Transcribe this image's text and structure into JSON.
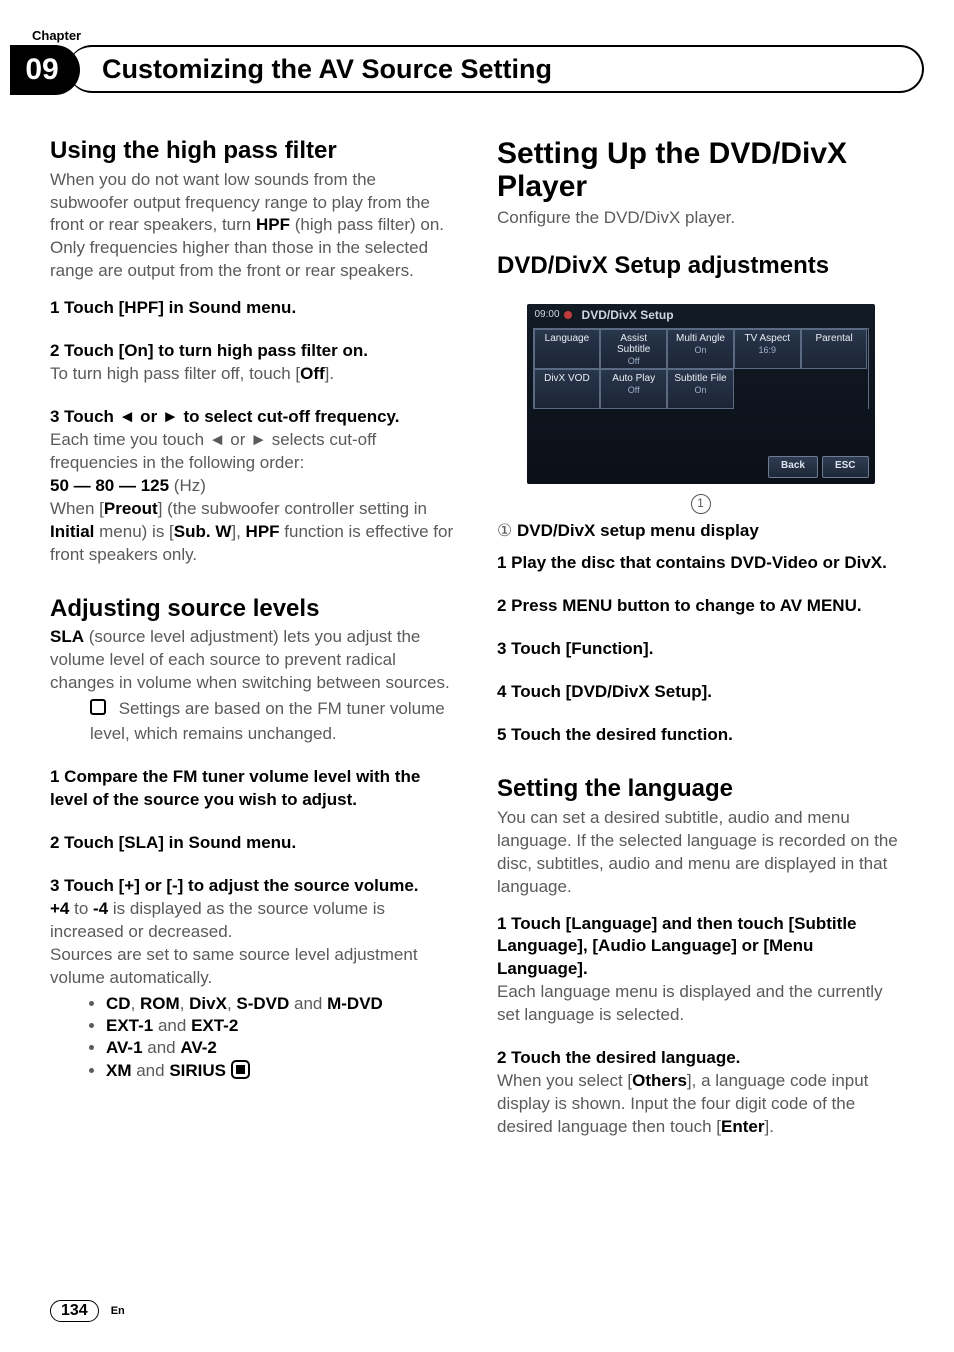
{
  "header": {
    "chapter_label": "Chapter",
    "chapter_number": "09",
    "title": "Customizing the AV Source Setting"
  },
  "left": {
    "high_pass": {
      "heading": "Using the high pass filter",
      "intro_a": "When you do not want low sounds from the subwoofer output frequency range to play from the front or rear speakers, turn ",
      "intro_bold": "HPF",
      "intro_b": " (high pass filter) on. Only frequencies higher than those in the selected range are output from the front or rear speakers.",
      "step1": "1    Touch [HPF] in Sound menu.",
      "step2": "2    Touch [On] to turn high pass filter on.",
      "step2_follow_a": "To turn high pass filter off, touch [",
      "step2_follow_bold": "Off",
      "step2_follow_b": "].",
      "step3": "3    Touch ◄ or ► to select cut-off frequency.",
      "step3_follow": "Each time you touch ◄ or ► selects cut-off frequencies in the following order:",
      "freq_line": "50 — 80 — 125",
      "freq_unit": " (Hz)",
      "preout_a": "When [",
      "preout_b": "Preout",
      "preout_c": "] (the subwoofer controller setting in ",
      "preout_d": "Initial",
      "preout_e": " menu) is [",
      "preout_f": "Sub. W",
      "preout_g": "], ",
      "preout_h": "HPF",
      "preout_i": " function is effective for front speakers only."
    },
    "sla": {
      "heading": "Adjusting source levels",
      "intro_b1": "SLA",
      "intro_a": " (source level adjustment) lets you adjust the volume level of each source to prevent radical changes in volume when switching between sources.",
      "note": " Settings are based on the FM tuner volume level, which remains unchanged.",
      "step1": "1    Compare the FM tuner volume level with the level of the source you wish to adjust.",
      "step2": "2    Touch [SLA] in Sound menu.",
      "step3": "3    Touch [+] or [-] to adjust the source volume.",
      "step3_follow_a": "+4",
      "step3_follow_b": " to ",
      "step3_follow_c": "-4",
      "step3_follow_d": " is displayed as the source volume is increased or decreased.",
      "step3_follow2": "Sources are set to same source level adjustment volume automatically.",
      "bullets": [
        {
          "a": "CD",
          "b": ", ",
          "c": "ROM",
          "d": ", ",
          "e": "DivX",
          "f": ", ",
          "g": "S-DVD",
          "h": " and ",
          "i": "M-DVD"
        },
        {
          "a": "EXT-1",
          "b": " and ",
          "c": "EXT-2"
        },
        {
          "a": "AV-1",
          "b": " and ",
          "c": "AV-2"
        },
        {
          "a": "XM",
          "b": " and ",
          "c": "SIRIUS"
        }
      ]
    }
  },
  "right": {
    "setup": {
      "heading": "Setting Up the DVD/DivX Player",
      "intro": "Configure the DVD/DivX player.",
      "sub_heading": "DVD/DivX Setup adjustments",
      "screen": {
        "time": "09:00",
        "title": "DVD/DivX Setup",
        "row1": [
          {
            "label": "Language",
            "subs": []
          },
          {
            "label": "Assist Subtitle",
            "subs": [
              "Off"
            ]
          },
          {
            "label": "Multi Angle",
            "subs": [
              "On"
            ]
          },
          {
            "label": "TV Aspect",
            "subs": [
              "16:9"
            ]
          },
          {
            "label": "Parental",
            "subs": []
          }
        ],
        "row2": [
          {
            "label": "DivX VOD",
            "subs": []
          },
          {
            "label": "Auto Play",
            "subs": [
              "Off"
            ]
          },
          {
            "label": "Subtitle File",
            "subs": [
              "On"
            ]
          }
        ],
        "buttons": {
          "back": "Back",
          "esc": "ESC"
        }
      },
      "caption_num": "①",
      "caption_label": "DVD/DivX setup menu display",
      "step1": "1    Play the disc that contains DVD-Video or DivX.",
      "step2": "2    Press MENU button to change to AV MENU.",
      "step3": "3    Touch [Function].",
      "step4": "4    Touch [DVD/DivX Setup].",
      "step5": "5    Touch the desired function."
    },
    "language": {
      "heading": "Setting the language",
      "intro": "You can set a desired subtitle, audio and menu language. If the selected language is recorded on the disc, subtitles, audio and menu are displayed in that language.",
      "step1": "1    Touch [Language] and then touch [Subtitle Language], [Audio Language] or [Menu Language].",
      "step1_follow": "Each language menu is displayed and the currently set language is selected.",
      "step2": "2    Touch the desired language.",
      "step2_follow_a": "When you select [",
      "step2_follow_b": "Others",
      "step2_follow_c": "], a language code input display is shown. Input the four digit code of the desired language then touch [",
      "step2_follow_d": "Enter",
      "step2_follow_e": "]."
    }
  },
  "footer": {
    "page": "134",
    "lang": "En"
  }
}
